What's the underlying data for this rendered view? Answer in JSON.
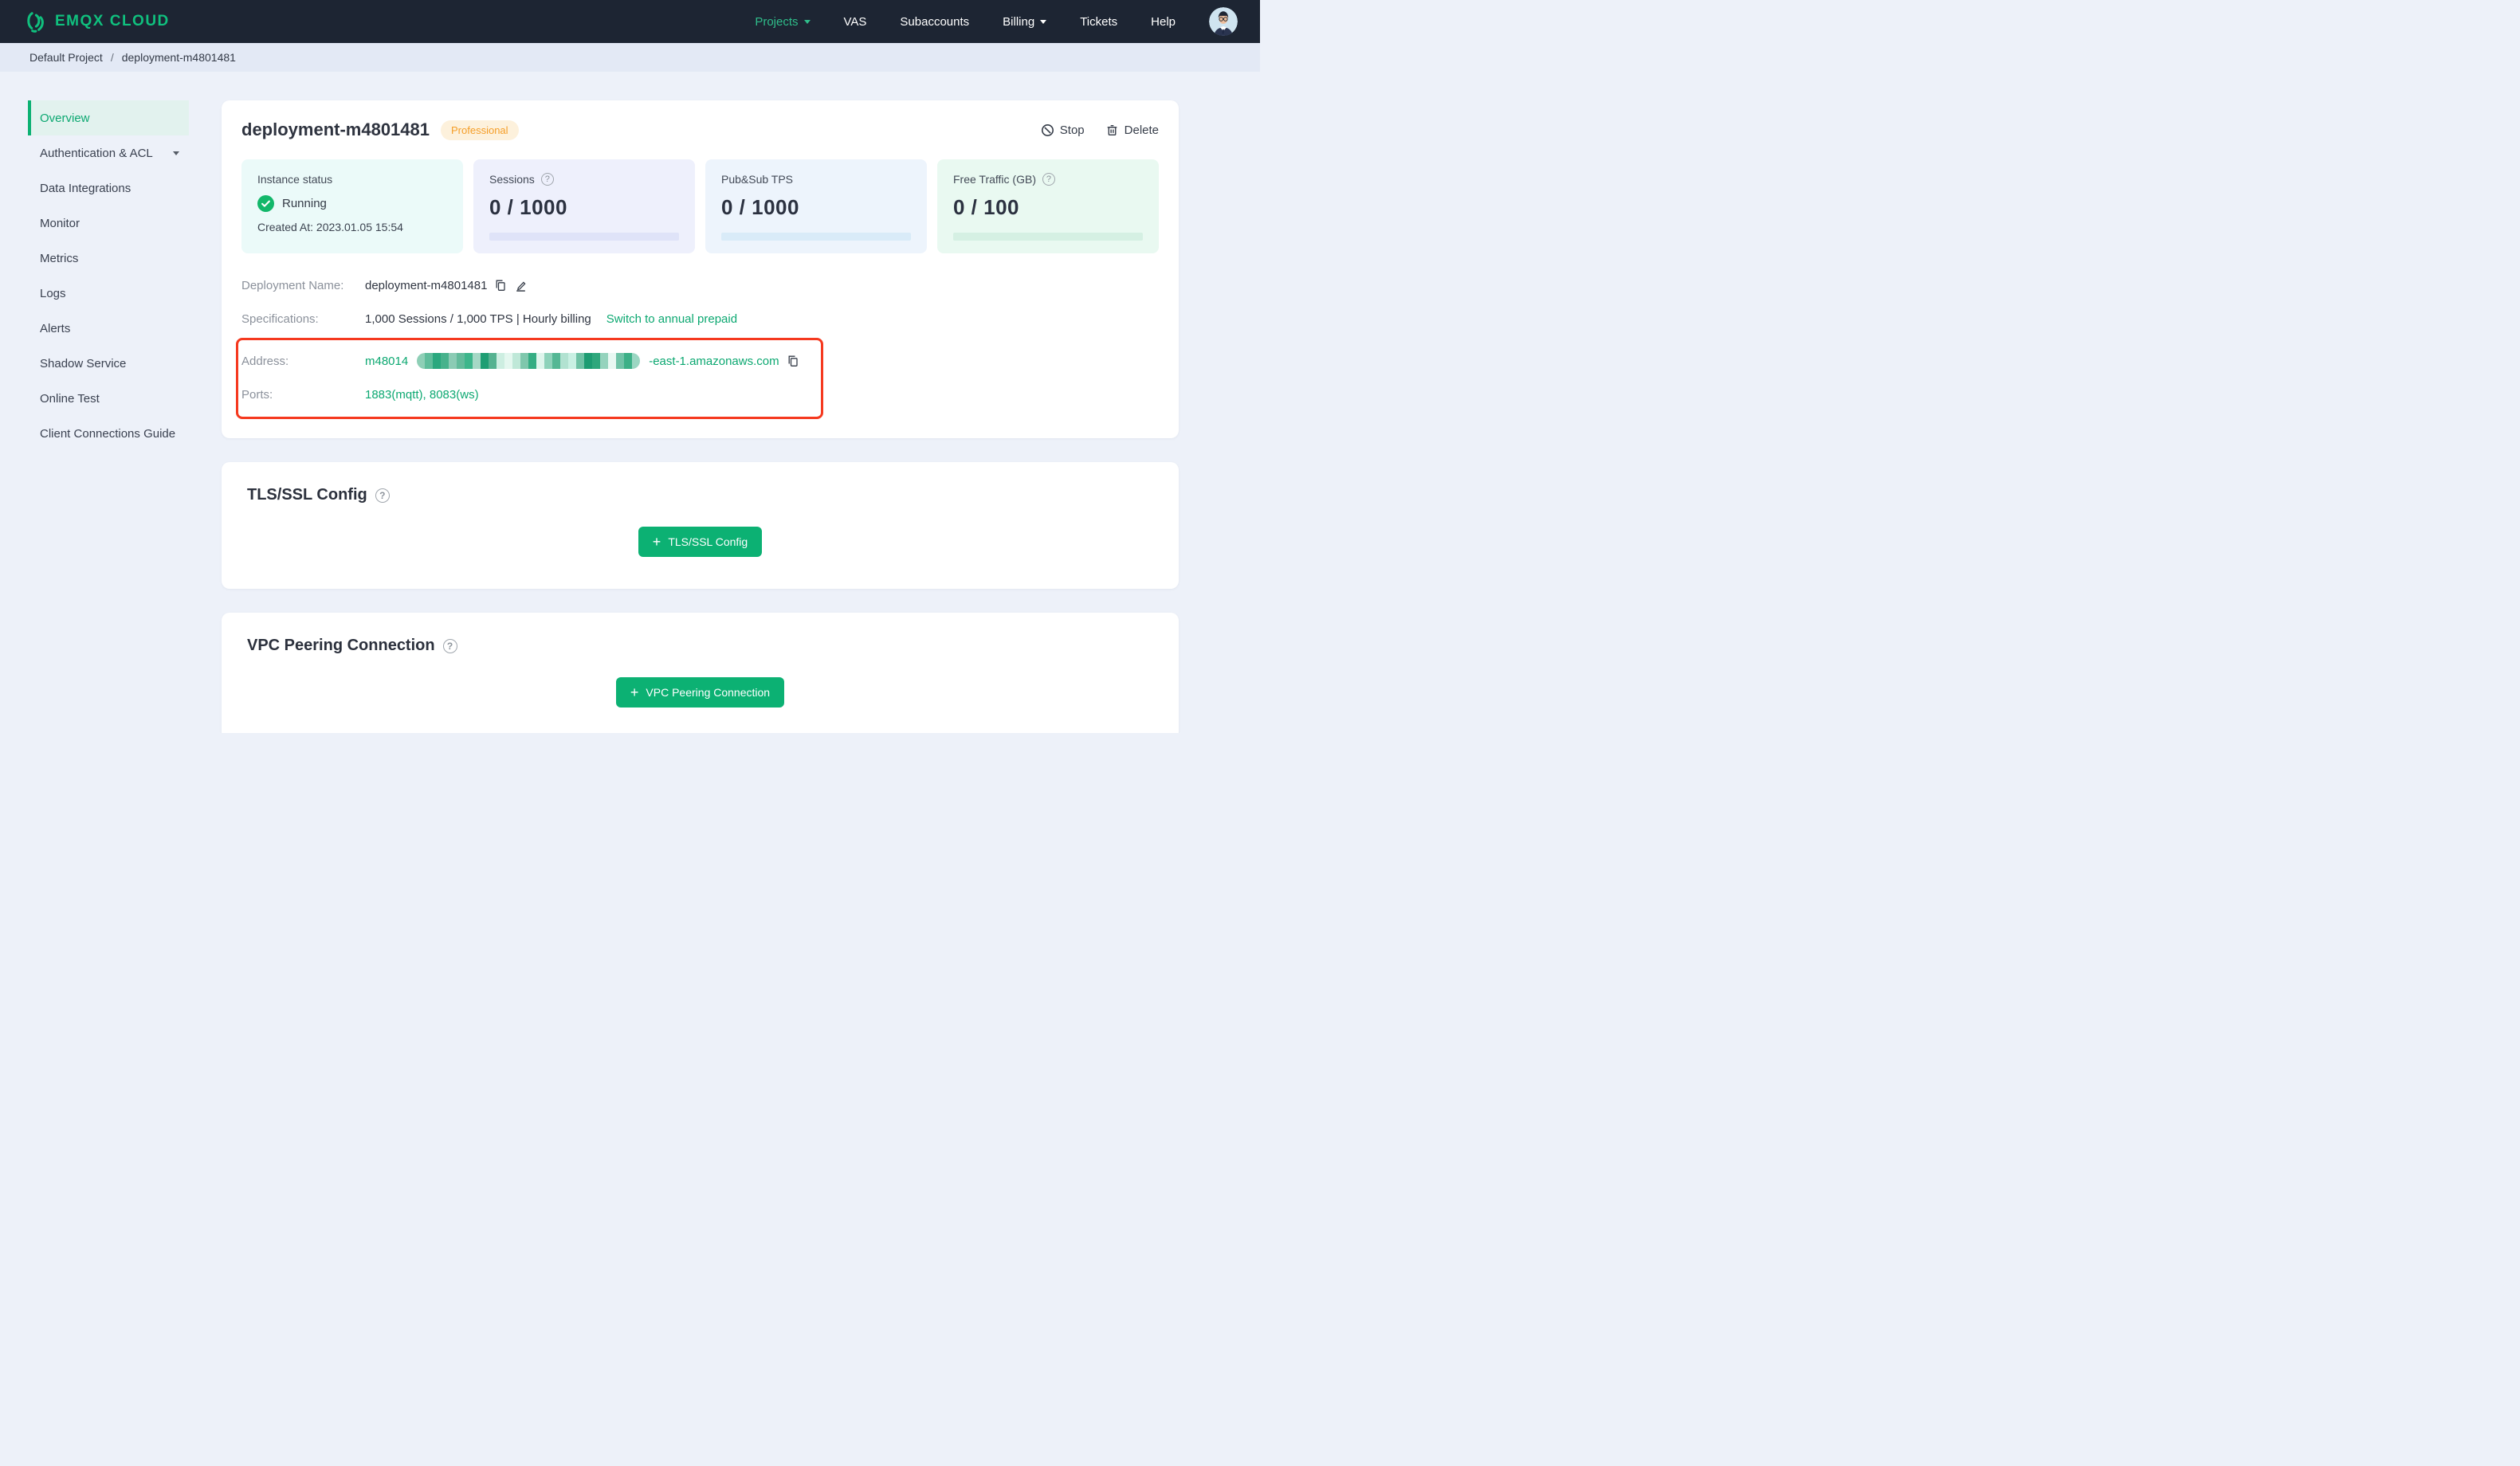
{
  "brand": {
    "name": "EMQX CLOUD",
    "color": "#00b173"
  },
  "navbar": {
    "items": [
      {
        "label": "Projects",
        "active": true,
        "caret": true
      },
      {
        "label": "VAS"
      },
      {
        "label": "Subaccounts"
      },
      {
        "label": "Billing",
        "caret": true
      },
      {
        "label": "Tickets"
      },
      {
        "label": "Help"
      }
    ]
  },
  "breadcrumb": {
    "project": "Default Project",
    "separator": "/",
    "current": "deployment-m4801481"
  },
  "sidebar": {
    "active_color": "#0ca871",
    "items": [
      {
        "label": "Overview",
        "active": true
      },
      {
        "label": "Authentication & ACL",
        "caret": true
      },
      {
        "label": "Data Integrations"
      },
      {
        "label": "Monitor"
      },
      {
        "label": "Metrics"
      },
      {
        "label": "Logs"
      },
      {
        "label": "Alerts"
      },
      {
        "label": "Shadow Service"
      },
      {
        "label": "Online Test"
      },
      {
        "label": "Client Connections Guide"
      }
    ]
  },
  "overview": {
    "title": "deployment-m4801481",
    "badge": {
      "label": "Professional",
      "color": "#f59e28",
      "bg": "#fdf1dc"
    },
    "actions": {
      "stop": "Stop",
      "delete": "Delete"
    },
    "stats": [
      {
        "label": "Instance status",
        "status": "Running",
        "created": "Created At: 2023.01.05 15:54",
        "bg": "#ebfaf9",
        "status_color": "#12b76a"
      },
      {
        "label": "Sessions",
        "value": "0 / 1000",
        "has_help": true,
        "bg": "#eef0fc",
        "bar": "#dfe3f8"
      },
      {
        "label": "Pub&Sub TPS",
        "value": "0 / 1000",
        "has_help": false,
        "bg": "#edf4fc",
        "bar": "#d9ebf8"
      },
      {
        "label": "Free Traffic (GB)",
        "value": "0 / 100",
        "has_help": true,
        "bg": "#e9f9f1",
        "bar": "#d5f0e3"
      }
    ],
    "details": {
      "name_label": "Deployment Name:",
      "name_value": "deployment-m4801481",
      "spec_label": "Specifications:",
      "spec_value": "1,000 Sessions / 1,000 TPS | Hourly billing",
      "spec_link": "Switch to annual prepaid",
      "address_label": "Address:",
      "address_prefix": "m48014",
      "address_suffix": "-east-1.amazonaws.com",
      "ports_label": "Ports:",
      "ports_value": "1883(mqtt), 8083(ws)",
      "highlight_color": "#f5391f",
      "redaction_colors": [
        "#8ecfb6",
        "#5fbd9b",
        "#2aa87e",
        "#47b28c",
        "#8bcbb4",
        "#63bb9b",
        "#3db68b",
        "#a5d8c5",
        "#1f9e73",
        "#55b290",
        "#cdeee1",
        "#e4f7ef",
        "#bfe8d8",
        "#7fc7ac",
        "#35ad83",
        "#dff5ec",
        "#8ed2ba",
        "#54b794",
        "#b2e2d1",
        "#c9f0e3",
        "#6fc2a5",
        "#1d9c72",
        "#2fa77c",
        "#95d3bd",
        "#e8f8f2",
        "#70c3a7",
        "#3cb087",
        "#9bd6c2"
      ]
    }
  },
  "tls": {
    "title": "TLS/SSL Config",
    "button_label": "TLS/SSL Config",
    "plus": "+"
  },
  "vpc": {
    "title": "VPC Peering Connection",
    "button_label": "VPC Peering Connection",
    "plus": "+"
  },
  "accent_green": "#0cb173"
}
